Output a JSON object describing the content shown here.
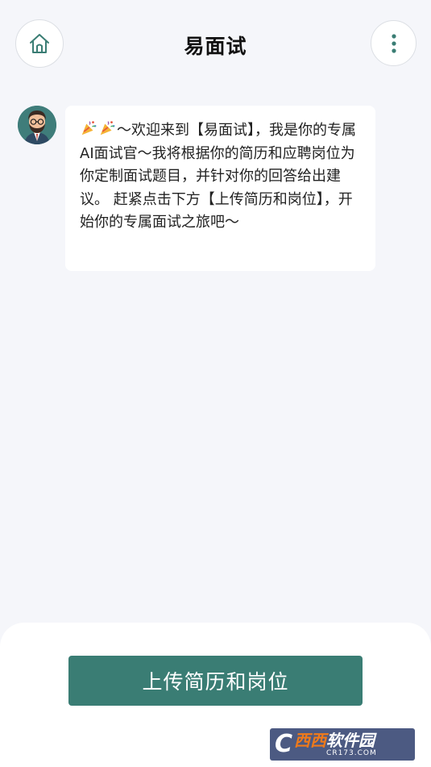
{
  "header": {
    "title": "易面试",
    "home_icon": "home-icon",
    "menu_icon": "more-vertical-icon"
  },
  "chat": {
    "avatar_icon": "interviewer-avatar",
    "message": "～欢迎来到【易面试】，我是你的专属AI面试官～我将根据你的简历和应聘岗位为你定制面试题目，并针对你的回答给出建议。 赶紧点击下方【上传简历和岗位】，开始你的专属面试之旅吧～",
    "message_emoji": "party-popper-icon"
  },
  "footer": {
    "upload_label": "上传简历和岗位"
  },
  "watermark": {
    "name_part1": "西西",
    "name_part2": "软件园",
    "domain": "CR173.COM"
  },
  "colors": {
    "accent": "#3a7d74",
    "background": "#f5f6fa"
  }
}
